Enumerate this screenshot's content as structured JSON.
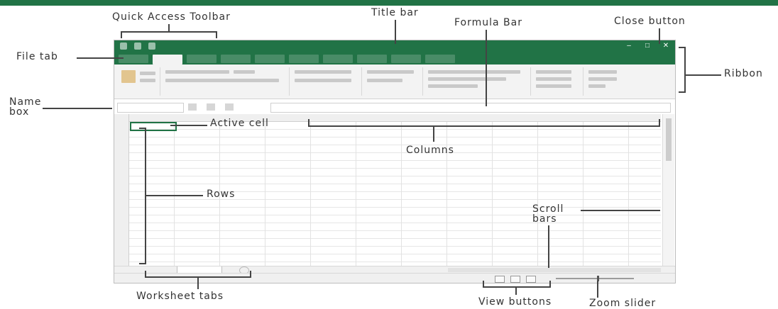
{
  "labels": {
    "quick_access_toolbar": "Quick Access Toolbar",
    "title_bar": "Title bar",
    "formula_bar": "Formula Bar",
    "close_button": "Close button",
    "file_tab": "File tab",
    "ribbon": "Ribbon",
    "name_box": "Name\nbox",
    "active_cell": "Active cell",
    "columns": "Columns",
    "rows": "Rows",
    "scroll_bars": "Scroll\nbars",
    "worksheet_tabs": "Worksheet tabs",
    "view_buttons": "View buttons",
    "zoom_slider": "Zoom slider"
  },
  "colors": {
    "excel_green": "#217346",
    "callout_text": "#333333",
    "leader_lines": "#444444"
  },
  "icons": [
    "save-icon",
    "undo-icon",
    "redo-icon",
    "minimize-icon",
    "maximize-icon",
    "close-icon",
    "normal-view-icon",
    "page-layout-view-icon",
    "page-break-view-icon"
  ]
}
